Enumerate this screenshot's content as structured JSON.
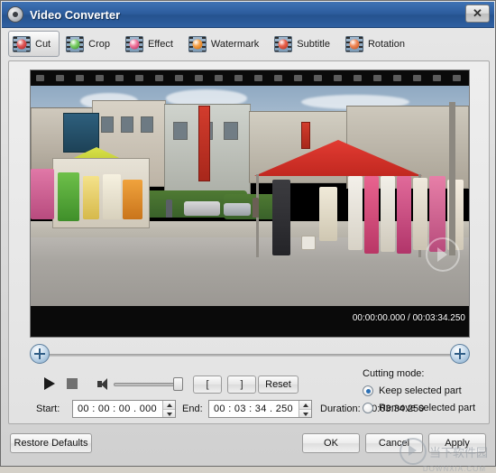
{
  "window": {
    "title": "Video Converter",
    "close_label": "✕",
    "app_icon": "disc-icon"
  },
  "toolbar": {
    "items": [
      {
        "label": "Cut",
        "icon": "film-cut-icon",
        "active": true
      },
      {
        "label": "Crop",
        "icon": "film-crop-icon",
        "active": false
      },
      {
        "label": "Effect",
        "icon": "film-effect-icon",
        "active": false
      },
      {
        "label": "Watermark",
        "icon": "film-watermark-icon",
        "active": false
      },
      {
        "label": "Subtitle",
        "icon": "film-subtitle-icon",
        "active": false
      },
      {
        "label": "Rotation",
        "icon": "film-rotation-icon",
        "active": false
      }
    ]
  },
  "preview": {
    "time_overlay": "00:00:00.000 / 00:03:34.250",
    "current_time": "00:00:00.000",
    "total_time": "00:03:34.250",
    "scene_description": "Street market with red canopy tent and clothing stalls"
  },
  "trim": {
    "left_handle": "trim-start-handle",
    "right_handle": "trim-end-handle"
  },
  "controls": {
    "play": "play-icon",
    "stop": "stop-icon",
    "volume": "volume-icon",
    "mark_in": "[",
    "mark_out": "]",
    "reset": "Reset"
  },
  "time_fields": {
    "start_label": "Start:",
    "start_value": "00 : 00 : 00 . 000",
    "end_label": "End:",
    "end_value": "00 : 03 : 34 . 250",
    "duration_label": "Duration:",
    "duration_value": "00:03:34.250"
  },
  "cutting_mode": {
    "title": "Cutting mode:",
    "options": [
      {
        "label": "Keep selected part",
        "checked": true
      },
      {
        "label": "Remove selected part",
        "checked": false
      }
    ]
  },
  "footer": {
    "restore": "Restore Defaults",
    "ok": "OK",
    "cancel": "Cancel",
    "apply": "Apply"
  },
  "watermark": {
    "text": "当下软件园",
    "sub": "DOWNXIA.COM"
  },
  "colors": {
    "titlebar": "#2d5d9e",
    "accent": "#2a6fb5",
    "panel": "#e8e8e8",
    "tent_red": "#c12820"
  }
}
